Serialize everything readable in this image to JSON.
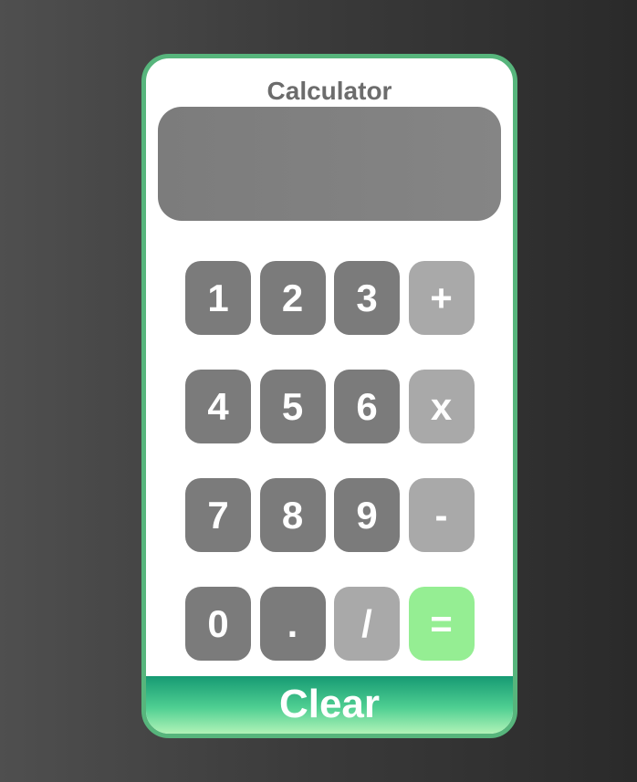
{
  "app": {
    "title": "Calculator"
  },
  "display": {
    "value": ""
  },
  "keypad": {
    "rows": [
      [
        {
          "label": "1",
          "kind": "num"
        },
        {
          "label": "2",
          "kind": "num"
        },
        {
          "label": "3",
          "kind": "num"
        },
        {
          "label": "+",
          "kind": "op"
        }
      ],
      [
        {
          "label": "4",
          "kind": "num"
        },
        {
          "label": "5",
          "kind": "num"
        },
        {
          "label": "6",
          "kind": "num"
        },
        {
          "label": "x",
          "kind": "op"
        }
      ],
      [
        {
          "label": "7",
          "kind": "num"
        },
        {
          "label": "8",
          "kind": "num"
        },
        {
          "label": "9",
          "kind": "num"
        },
        {
          "label": "-",
          "kind": "op"
        }
      ],
      [
        {
          "label": "0",
          "kind": "num"
        },
        {
          "label": ".",
          "kind": "num"
        },
        {
          "label": "/",
          "kind": "op"
        },
        {
          "label": "=",
          "kind": "eq"
        }
      ]
    ]
  },
  "clear": {
    "label": "Clear"
  },
  "colors": {
    "frame_border": "#57b57c",
    "number_key": "#7b7b7b",
    "operator_key": "#a9a9a9",
    "equals_key": "#95ee93",
    "display": "#808080",
    "title_text": "#6c6c6c"
  }
}
